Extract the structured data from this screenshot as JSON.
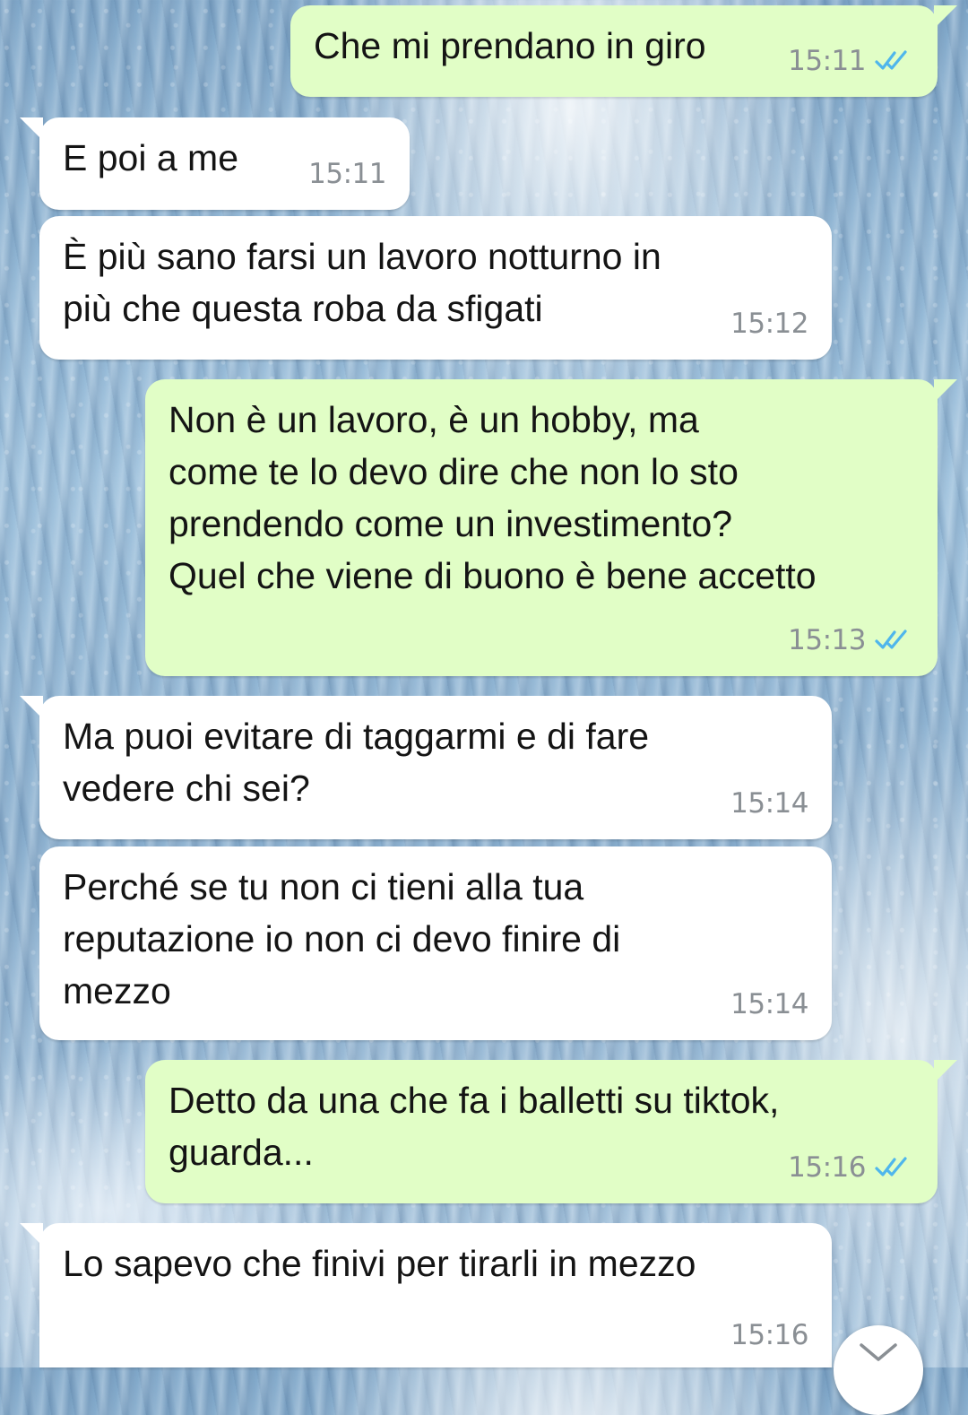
{
  "messages": [
    {
      "direction": "outgoing",
      "text": "Che mi prendano in giro",
      "time": "15:11",
      "status": "read"
    },
    {
      "direction": "incoming",
      "text": "E poi a me",
      "time": "15:11"
    },
    {
      "direction": "incoming",
      "text": "È più sano farsi un lavoro notturno in\npiù che questa roba da sfigati",
      "time": "15:12"
    },
    {
      "direction": "outgoing",
      "text": "Non è un lavoro, è un hobby, ma\ncome te lo devo dire che non lo sto\nprendendo come un investimento?\nQuel che viene di buono è bene accetto",
      "time": "15:13",
      "status": "read"
    },
    {
      "direction": "incoming",
      "text": "Ma puoi evitare di taggarmi e di fare\nvedere chi sei?",
      "time": "15:14"
    },
    {
      "direction": "incoming",
      "text": "Perché se tu non ci tieni alla tua\nreputazione io non ci devo finire di\nmezzo",
      "time": "15:14"
    },
    {
      "direction": "outgoing",
      "text": "Detto da una che fa i balletti su tiktok,\nguarda...",
      "time": "15:16",
      "status": "read"
    },
    {
      "direction": "incoming",
      "text": "Lo sapevo che finivi per tirarli in mezzo",
      "time": "15:16"
    }
  ],
  "colors": {
    "outgoing_bubble": "#e1fec6",
    "incoming_bubble": "#ffffff",
    "read_ticks": "#4fb6ec",
    "timestamp": "#8a8f94"
  },
  "icons": {
    "read_receipt": "double-check-icon",
    "scroll": "chevron-down-icon"
  }
}
